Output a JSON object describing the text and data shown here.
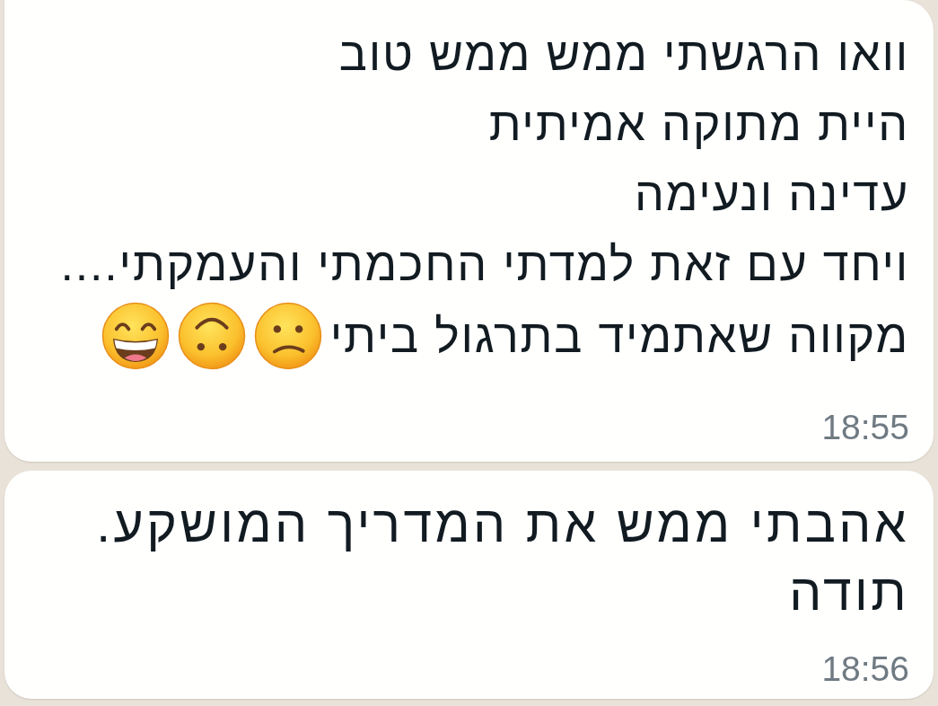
{
  "messages": [
    {
      "lines": [
        {
          "text": "וואו הרגשתי ממש ממש טוב"
        },
        {
          "text": "היית מתוקה אמיתית"
        },
        {
          "text": "עדינה ונעימה"
        },
        {
          "text": "ויחד עם זאת למדתי החכמתי והעמקתי...."
        },
        {
          "text": "מקווה שאתמיד בתרגול ביתי",
          "emojis": [
            {
              "kind": "confused"
            },
            {
              "kind": "upside-down"
            },
            {
              "kind": "grinning"
            }
          ]
        }
      ],
      "time": "18:55"
    },
    {
      "lines": [
        {
          "text": "אהבתי ממש את המדריך המושקע."
        },
        {
          "text": "תודה"
        }
      ],
      "time": "18:56"
    }
  ]
}
